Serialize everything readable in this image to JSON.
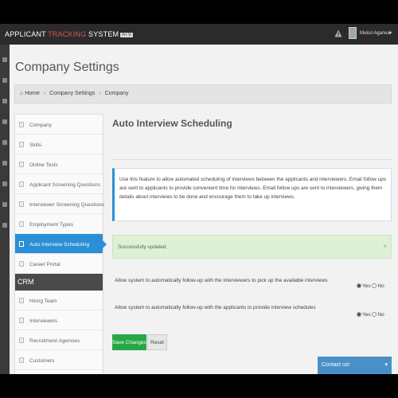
{
  "topbar": {
    "brand_part1": "APPLICANT ",
    "brand_accent": "TRACKING",
    "brand_part2": " SYSTEM",
    "brand_badge": "ATS",
    "user_name": "Mukul Agarwal",
    "user_caret": "▾",
    "icons": [
      "warning-icon",
      "avatar"
    ]
  },
  "page": {
    "title": "Company Settings",
    "breadcrumb": {
      "home": "Home",
      "separator": "›",
      "level1": "Company Settings",
      "level2": "Company"
    }
  },
  "sidemenu": {
    "items_top": [
      {
        "label": "Company"
      },
      {
        "label": "Skills"
      },
      {
        "label": "Online Tests"
      },
      {
        "label": "Applicant Screening Questions"
      },
      {
        "label": "Interviewer Screening Questions"
      },
      {
        "label": "Employment Types"
      },
      {
        "label": "Auto Interview Scheduling",
        "active": true
      },
      {
        "label": "Career Portal"
      }
    ],
    "section_label": "CRM",
    "items_crm": [
      {
        "label": "Hiring Team"
      },
      {
        "label": "Interviewers"
      },
      {
        "label": "Recruitment Agencies"
      },
      {
        "label": "Customers"
      }
    ]
  },
  "content": {
    "title": "Auto Interview Scheduling",
    "info_text": "Use this feature to allow automated scheduling of interviews between the applicants and interviewers. Email follow ups are sent to applicants to provide convenient time for interviews. Email follow ups are sent to interviewers, giving them details about interviews to be done and encourage them to take up interviews.",
    "success_text": "Successfully updated.",
    "success_close": "×",
    "options": [
      {
        "label": "Allow system to automatically follow-up with the interviewers to pick up the available interviews",
        "selected": "Yes"
      },
      {
        "label": "Allow system to automatically follow-up with the applicants to provide interview schedules",
        "selected": "Yes"
      }
    ],
    "radio_yes": "Yes",
    "radio_no": "No",
    "save_label": "Save Changes",
    "reset_label": "Reset"
  },
  "contact": {
    "label": "Contact us!",
    "caret": "▾"
  },
  "colors": {
    "accent_blue": "#2a8fd6",
    "save_green": "#28a745",
    "success_bg": "#dff0d8",
    "brand_red": "#d9534f"
  }
}
